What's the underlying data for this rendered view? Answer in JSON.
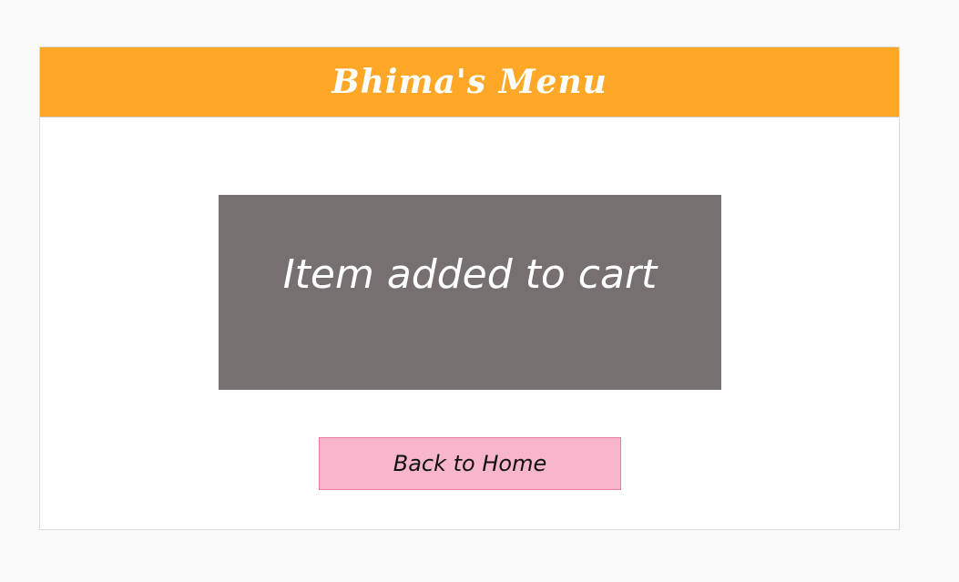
{
  "header": {
    "title": "Bhima's Menu"
  },
  "message": {
    "text": "Item added to cart"
  },
  "actions": {
    "back_label": "Back to Home"
  },
  "colors": {
    "header_bg": "#ffa726",
    "message_bg": "#767170",
    "button_bg": "#f8b6cd",
    "button_border": "#ef7aa4"
  }
}
